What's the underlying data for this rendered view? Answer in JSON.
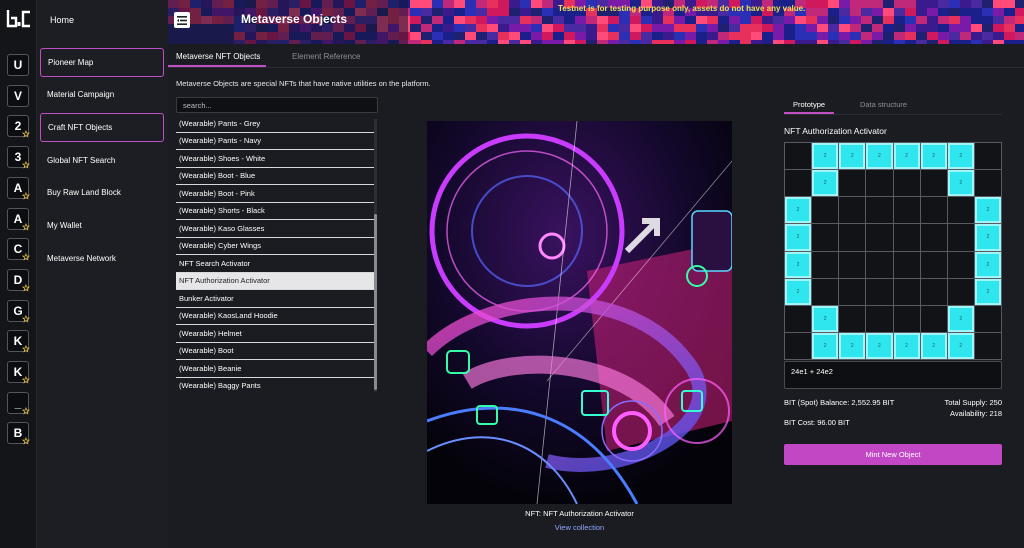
{
  "brand": {
    "logo_text": "b.c",
    "accent": "#c14fc4",
    "cyan": "#2fe6ee"
  },
  "rail": {
    "items": [
      {
        "label": "U",
        "star": false
      },
      {
        "label": "V",
        "star": false
      },
      {
        "label": "2",
        "star": true
      },
      {
        "label": "3",
        "star": true
      },
      {
        "label": "A",
        "star": true
      },
      {
        "label": "A",
        "star": true
      },
      {
        "label": "C",
        "star": true
      },
      {
        "label": "D",
        "star": true
      },
      {
        "label": "G",
        "star": true
      },
      {
        "label": "K",
        "star": true
      },
      {
        "label": "K",
        "star": true
      },
      {
        "label": "_",
        "star": true
      },
      {
        "label": "B",
        "star": true
      }
    ]
  },
  "sidebar": {
    "home": "Home",
    "items": [
      {
        "label": "Pioneer Map",
        "active": true
      },
      {
        "label": "Material Campaign",
        "active": false
      },
      {
        "label": "Craft NFT Objects",
        "active": true
      },
      {
        "label": "Global NFT Search",
        "active": false
      },
      {
        "label": "Buy Raw Land Block",
        "active": false
      },
      {
        "label": "My Wallet",
        "active": false
      },
      {
        "label": "Metaverse Network",
        "active": false
      }
    ]
  },
  "header": {
    "title": "Metaverse Objects",
    "warning": "Testnet is for testing purpose only, assets do not have any value."
  },
  "main": {
    "tabs": [
      "Metaverse NFT Objects",
      "Element Reference"
    ],
    "intro": "Metaverse Objects are special NFTs that have native utilities on the platform.",
    "search_placeholder": "search...",
    "list": [
      "(Wearable) Pants - Grey",
      "(Wearable) Pants - Navy",
      "(Wearable) Shoes - White",
      "(Wearable) Boot - Blue",
      "(Wearable) Boot - Pink",
      "(Wearable) Shorts - Black",
      "(Wearable) Kaso Glasses",
      "(Wearable) Cyber Wings",
      "NFT Search Activator",
      "NFT Authorization Activator",
      "Bunker Activator",
      "(Wearable) KaosLand Hoodie",
      "(Wearable) Helmet",
      "(Wearable) Boot",
      "(Wearable) Beanie",
      "(Wearable) Baggy Pants"
    ],
    "selected_index": 9,
    "art_caption": "NFT: NFT Authorization Activator",
    "view_collection": "View collection"
  },
  "panel": {
    "tabs": [
      "Prototype",
      "Data structure"
    ],
    "title": "NFT Authorization Activator",
    "cell_label": "2",
    "pattern": [
      "01111110",
      "01000010",
      "10000001",
      "10000001",
      "10000001",
      "10000001",
      "01000010",
      "01111110"
    ],
    "formula": "24e1 + 24e2",
    "balance": "BIT (Spot) Balance: 2,552.95 BIT",
    "cost": "BIT Cost: 96.00 BIT",
    "supply": "Total Supply: 250",
    "availability": "Availability: 218",
    "mint_label": "Mint New Object"
  }
}
